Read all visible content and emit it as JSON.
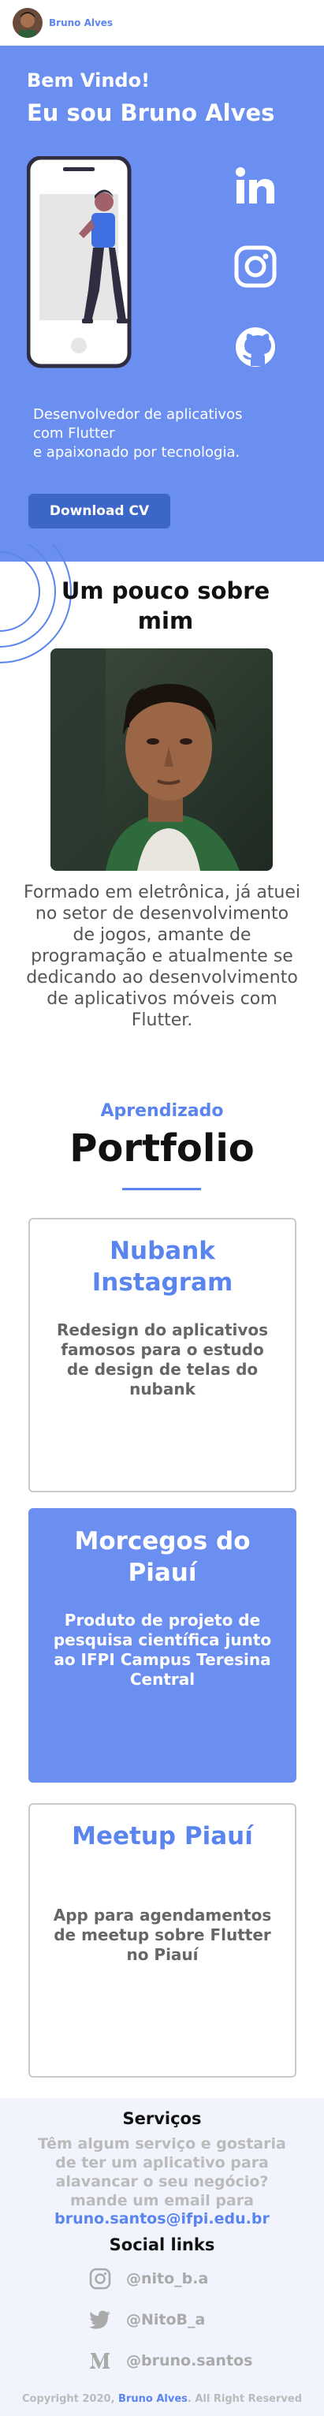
{
  "nav": {
    "brand": "Bruno Alves"
  },
  "hero": {
    "greeting": "Bem Vindo!",
    "title": "Eu sou Bruno Alves",
    "description_lines": [
      "Desenvolvedor de aplicativos",
      "com Flutter",
      "e apaixonado por tecnologia."
    ],
    "cv_button": "Download CV",
    "icons": [
      "linkedin-icon",
      "instagram-icon",
      "github-icon"
    ]
  },
  "about": {
    "title": "Um pouco sobre mim",
    "text": "Formado em eletrônica, já atuei no setor de desenvolvimento de jogos, amante de programação e atualmente se dedicando ao desenvolvimento de aplicativos móveis com Flutter."
  },
  "portfolio": {
    "subtitle": "Aprendizado",
    "title": "Portfolio",
    "projects": [
      {
        "title": "Nubank Instagram",
        "description": "Redesign do aplicativos famosos para o estudo de design de telas do nubank"
      },
      {
        "title": "Morcegos do Piauí",
        "description": "Produto de projeto de pesquisa científica junto ao IFPI Campus Teresina Central"
      },
      {
        "title": "Meetup Piauí",
        "description": "App para agendamentos de meetup sobre Flutter no Piauí"
      }
    ]
  },
  "footer": {
    "services_title": "Serviços",
    "services_text": "Têm algum serviço e gostaria de ter um aplicativo para alavancar o seu negócio? mande um email para",
    "email": "bruno.santos@ifpi.edu.br",
    "social_title": "Social links",
    "social": [
      {
        "icon": "instagram-icon",
        "handle": "@nito_b.a"
      },
      {
        "icon": "twitter-icon",
        "handle": "@NitoB_a"
      },
      {
        "icon": "medium-icon",
        "handle": "@bruno.santos"
      }
    ],
    "copyright_prefix": "Copyright 2020,",
    "copyright_name": "Bruno Alves",
    "copyright_suffix": ". All Right Reserved"
  },
  "colors": {
    "primary": "#6b8ff0",
    "accent": "#5a85ee",
    "button": "#3d66c9",
    "footer_bg": "#f1f3fd"
  }
}
